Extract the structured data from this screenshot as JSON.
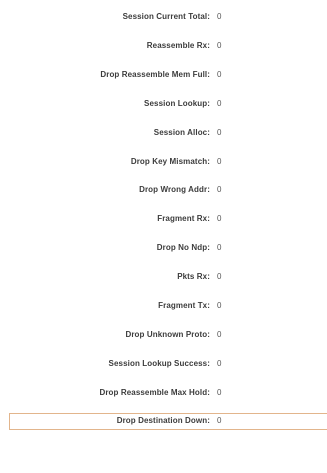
{
  "stats": [
    {
      "label": "Session Current Total:",
      "value": "0"
    },
    {
      "label": "Reassemble Rx:",
      "value": "0"
    },
    {
      "label": "Drop Reassemble Mem Full:",
      "value": "0"
    },
    {
      "label": "Session Lookup:",
      "value": "0"
    },
    {
      "label": "Session Alloc:",
      "value": "0"
    },
    {
      "label": "Drop Key Mismatch:",
      "value": "0"
    },
    {
      "label": "Drop Wrong Addr:",
      "value": "0"
    },
    {
      "label": "Fragment Rx:",
      "value": "0"
    },
    {
      "label": "Drop No Ndp:",
      "value": "0"
    },
    {
      "label": "Pkts Rx:",
      "value": "0"
    },
    {
      "label": "Fragment Tx:",
      "value": "0"
    },
    {
      "label": "Drop Unknown Proto:",
      "value": "0"
    },
    {
      "label": "Session Lookup Success:",
      "value": "0"
    },
    {
      "label": "Drop Reassemble Max Hold:",
      "value": "0"
    },
    {
      "label": "Drop Destination Down:",
      "value": "0"
    }
  ],
  "colors": {
    "label": "#3c3c3c",
    "value": "#555555",
    "highlight_border": "#e2b58c"
  }
}
